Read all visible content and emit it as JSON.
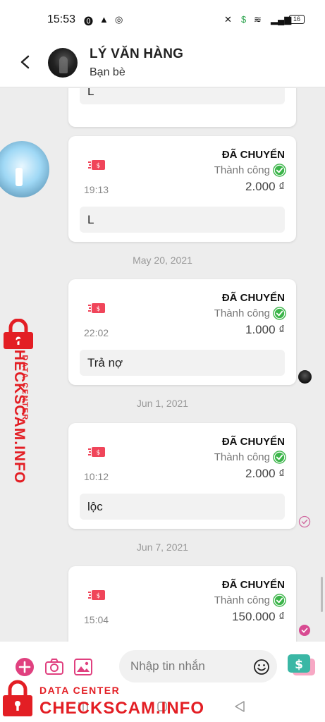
{
  "status_bar": {
    "time": "15:53",
    "battery": "16"
  },
  "header": {
    "name": "LÝ VĂN HÀNG",
    "status": "Bạn bè"
  },
  "messages": [
    {
      "note": "L"
    },
    {
      "title": "ĐÃ CHUYỂN",
      "status": "Thành công",
      "time": "19:13",
      "amount": "2.000 ₫",
      "note": "L"
    },
    {
      "date": "May 20, 2021"
    },
    {
      "title": "ĐÃ CHUYỂN",
      "status": "Thành công",
      "time": "22:02",
      "amount": "1.000 ₫",
      "note": "Trả nợ"
    },
    {
      "date": "Jun 1, 2021"
    },
    {
      "title": "ĐÃ CHUYỂN",
      "status": "Thành công",
      "time": "10:12",
      "amount": "2.000 ₫",
      "note": "lộc"
    },
    {
      "date": "Jun 7, 2021"
    },
    {
      "title": "ĐÃ CHUYỂN",
      "status": "Thành công",
      "time": "15:04",
      "amount": "150.000 ₫"
    }
  ],
  "input": {
    "placeholder": "Nhập tin nhắn"
  },
  "watermark": {
    "small": "DATA CENTER",
    "big": "CHECKSCAM.INFO"
  },
  "colors": {
    "accent": "#e0407f",
    "success": "#3cb54a",
    "transfer_icon": "#f0455a",
    "watermark": "#e31e24",
    "money_button": "#3ab7a5"
  }
}
